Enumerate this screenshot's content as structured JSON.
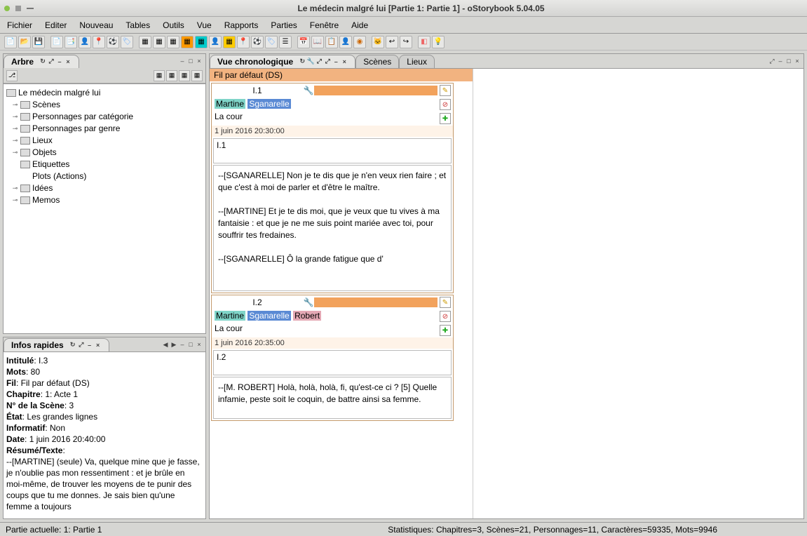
{
  "window_title": "Le médecin malgré lui [Partie 1: Partie 1] - oStorybook 5.04.05",
  "menu": [
    "Fichier",
    "Editer",
    "Nouveau",
    "Tables",
    "Outils",
    "Vue",
    "Rapports",
    "Parties",
    "Fenêtre",
    "Aide"
  ],
  "arbre": {
    "title": "Arbre",
    "root": "Le médecin malgré lui",
    "items": [
      "Scènes",
      "Personnages par catégorie",
      "Personnages par genre",
      "Lieux",
      "Objets",
      "Etiquettes",
      "Plots (Actions)",
      "Idées",
      "Memos"
    ]
  },
  "infos": {
    "title": "Infos rapides",
    "intitule_label": "Intitulé",
    "intitule_value": "I.3",
    "mots_label": "Mots",
    "mots_value": "80",
    "fil_label": "Fil",
    "fil_value": "Fil par défaut (DS)",
    "chapitre_label": "Chapitre",
    "chapitre_value": "1: Acte 1",
    "numscene_label": "N° de la Scène",
    "numscene_value": "3",
    "etat_label": "État",
    "etat_value": "Les grandes lignes",
    "informatif_label": "Informatif",
    "informatif_value": "Non",
    "date_label": "Date",
    "date_value": "1 juin 2016 20:40:00",
    "resume_label": "Résumé/Texte",
    "resume_text": "--[MARTINE] (seule) Va, quelque mine que je fasse, je n'oublie pas mon ressentiment : et je brûle en moi-même, de trouver les moyens de te punir des coups que tu me donnes. Je sais bien qu'une femme a toujours"
  },
  "chrono": {
    "title": "Vue chronologique",
    "tab_scenes": "Scènes",
    "tab_lieux": "Lieux",
    "strip": "Fil par défaut (DS)",
    "scenes": [
      {
        "num": "I.1",
        "chars": [
          {
            "name": "Martine",
            "cls": "teal"
          },
          {
            "name": "Sganarelle",
            "cls": "blue"
          }
        ],
        "loc": "La cour",
        "date": "1 juin 2016 20:30:00",
        "idbox": "I.1",
        "text": "--[SGANARELLE] Non je te dis que je n'en veux rien faire ; et que c'est à moi de parler et d'être le maître.\n\n--[MARTINE] Et je te dis moi, que je veux que tu vives à ma fantaisie : et que je ne me suis point mariée avec toi, pour souffrir tes fredaines.\n\n--[SGANARELLE] Ô la grande fatigue que d'"
      },
      {
        "num": "I.2",
        "chars": [
          {
            "name": "Martine",
            "cls": "teal"
          },
          {
            "name": "Sganarelle",
            "cls": "blue"
          },
          {
            "name": "Robert",
            "cls": "pink"
          }
        ],
        "loc": "La cour",
        "date": "1 juin 2016 20:35:00",
        "idbox": "I.2",
        "text": "--[M. ROBERT] Holà, holà, holà, fi, qu'est-ce ci ? [5] Quelle infamie, peste soit le coquin, de battre ainsi sa femme."
      }
    ]
  },
  "status": {
    "partie": "Partie actuelle: 1: Partie 1",
    "stats": "Statistiques: Chapitres=3,  Scènes=21,  Personnages=11,  Caractères=59335,  Mots=9946"
  },
  "icons": {
    "edit": "✎",
    "forbid": "⊘",
    "plus": "✚",
    "refresh": "↻",
    "pin": "⤢",
    "min": "–",
    "close": "×",
    "max": "□",
    "wrench": "🔧",
    "left": "◀",
    "right": "▶"
  }
}
